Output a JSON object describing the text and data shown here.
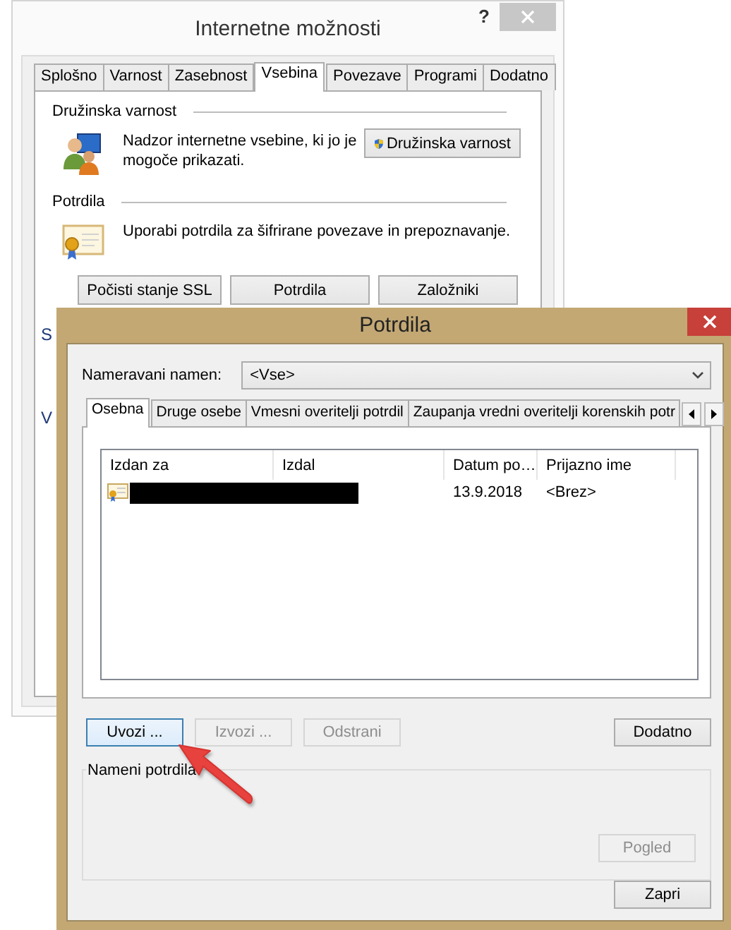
{
  "back_window": {
    "title": "Internetne možnosti",
    "help": "?",
    "tabs": [
      {
        "label": "Splošno",
        "selected": false
      },
      {
        "label": "Varnost",
        "selected": false
      },
      {
        "label": "Zasebnost",
        "selected": false
      },
      {
        "label": "Vsebina",
        "selected": true
      },
      {
        "label": "Povezave",
        "selected": false
      },
      {
        "label": "Programi",
        "selected": false
      },
      {
        "label": "Dodatno",
        "selected": false
      }
    ],
    "sections": [
      {
        "title": "Družinska varnost",
        "kind": "family",
        "text": "Nadzor internetne vsebine, ki jo je mogoče prikazati.",
        "buttons": [
          {
            "label": "Družinska varnost",
            "shield": true
          }
        ]
      },
      {
        "title": "Potrdila",
        "kind": "certificates",
        "text": "Uporabi potrdila za šifrirane povezave in prepoznavanje.",
        "buttons": [
          {
            "label": "Počisti stanje SSL",
            "shield": false
          },
          {
            "label": "Potrdila",
            "shield": false
          },
          {
            "label": "Založniki",
            "shield": false
          }
        ]
      }
    ],
    "covered_labels": [
      "S",
      "V"
    ]
  },
  "front_window": {
    "title": "Potrdila",
    "purpose_label": "Nameravani namen:",
    "purpose_value": "<Vse>",
    "tabs": [
      {
        "label": "Osebna",
        "selected": true
      },
      {
        "label": "Druge osebe",
        "selected": false
      },
      {
        "label": "Vmesni overitelji potrdil",
        "selected": false
      },
      {
        "label": "Zaupanja vredni overitelji korenskih potr",
        "selected": false
      }
    ],
    "table": {
      "columns": [
        "Izdan za",
        "Izdal",
        "Datum po…",
        "Prijazno ime"
      ],
      "rows": [
        {
          "redacted": true,
          "date": "13.9.2018",
          "friendly_name": "<Brez>"
        }
      ]
    },
    "buttons": [
      {
        "label": "Uvozi ...",
        "disabled": false,
        "focused": true
      },
      {
        "label": "Izvozi ...",
        "disabled": true,
        "focused": false
      },
      {
        "label": "Odstrani",
        "disabled": true,
        "focused": false
      }
    ],
    "advanced_button": {
      "label": "Dodatno",
      "disabled": false
    },
    "purposes_group": {
      "title": "Nameni potrdila",
      "view_button": {
        "label": "Pogled",
        "disabled": true
      }
    },
    "close_button": {
      "label": "Zapri",
      "disabled": false
    }
  }
}
